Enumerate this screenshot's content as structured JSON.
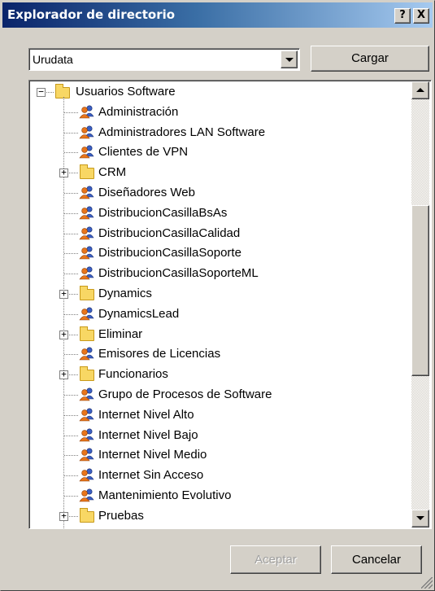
{
  "window": {
    "title": "Explorador de directorio",
    "help_label": "?",
    "close_label": "X"
  },
  "domain_select": {
    "value": "Urudata",
    "load_button_label": "Cargar"
  },
  "tree": {
    "root": {
      "label": "Usuarios Software",
      "expanded": true,
      "type": "folder"
    },
    "items": [
      {
        "label": "Administración",
        "type": "group"
      },
      {
        "label": "Administradores LAN Software",
        "type": "group"
      },
      {
        "label": "Clientes de VPN",
        "type": "group"
      },
      {
        "label": "CRM",
        "type": "folder",
        "expandable": true
      },
      {
        "label": "Diseñadores Web",
        "type": "group"
      },
      {
        "label": "DistribucionCasillaBsAs",
        "type": "group"
      },
      {
        "label": "DistribucionCasillaCalidad",
        "type": "group"
      },
      {
        "label": "DistribucionCasillaSoporte",
        "type": "group"
      },
      {
        "label": "DistribucionCasillaSoporteML",
        "type": "group"
      },
      {
        "label": "Dynamics",
        "type": "folder",
        "expandable": true
      },
      {
        "label": "DynamicsLead",
        "type": "group"
      },
      {
        "label": "Eliminar",
        "type": "folder",
        "expandable": true
      },
      {
        "label": "Emisores de Licencias",
        "type": "group"
      },
      {
        "label": "Funcionarios",
        "type": "folder",
        "expandable": true
      },
      {
        "label": "Grupo de Procesos de Software",
        "type": "group"
      },
      {
        "label": "Internet Nivel Alto",
        "type": "group"
      },
      {
        "label": "Internet Nivel Bajo",
        "type": "group"
      },
      {
        "label": "Internet Nivel Medio",
        "type": "group"
      },
      {
        "label": "Internet Sin Acceso",
        "type": "group"
      },
      {
        "label": "Mantenimiento Evolutivo",
        "type": "group"
      },
      {
        "label": "Pruebas",
        "type": "folder",
        "expandable": true
      }
    ]
  },
  "footer": {
    "accept_label": "Aceptar",
    "accept_enabled": false,
    "cancel_label": "Cancelar"
  },
  "colors": {
    "titlebar_start": "#0a246a",
    "titlebar_end": "#a6caf0",
    "face": "#d4d0c8",
    "folder": "#f8d764",
    "group_orange": "#e8751a",
    "group_blue": "#3a5fc4"
  }
}
